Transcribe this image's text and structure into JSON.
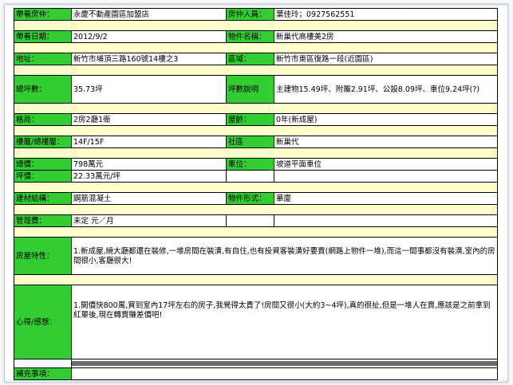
{
  "rows": {
    "r1": {
      "l1": "帶看房仲：",
      "v1": "永慶不動產園區加盟店",
      "l2": "房仲人員：",
      "v2": "葉佳玲；0927562551"
    },
    "r2": {
      "l1": "帶看日期：",
      "v1": "2012/9/2",
      "l2": "物件名稱：",
      "v2": "新巢代高樓美2房"
    },
    "r3": {
      "l1": "地址：",
      "v1": "新竹市埔頂三路160號14樓之3",
      "l2": "區域：",
      "v2": "新竹市東區復路一段(近園區)"
    },
    "r4": {
      "l1": "總坪數：",
      "v1": "35.73坪",
      "l2": "坪數說明",
      "v2": "主建物15.49坪、附屬2.91坪、公設8.09坪、車位9.24坪(?)"
    },
    "r5": {
      "l1": "格局：",
      "v1": "2房2廳1衛",
      "l2": "屋齡：",
      "v2": "0年(新成屋)"
    },
    "r6": {
      "l1": "樓層/總樓層：",
      "v1": "14F/15F",
      "l2": "社區",
      "v2": "新巢代"
    },
    "r7": {
      "l1": "總價：",
      "v1": "798萬元",
      "l2": "車位：",
      "v2": "坡道平面車位"
    },
    "r8": {
      "l1": "坪價：",
      "v1": "22.33萬元/坪",
      "l2": "",
      "v2": ""
    },
    "r9": {
      "l1": "建材結構：",
      "v1": "鋼筋混凝土",
      "l2": "物件形式：",
      "v2": "華廈"
    },
    "r10": {
      "l1": "管理費：",
      "v1": "未定 元／月"
    },
    "r11": {
      "l1": "房屋特性：",
      "v1": "1.新成屋,繞大廳都還在裝修,一堆房間在裝潢,有自住,也有投資客裝潢好要賣(網路上物件一堆),而這一間事都沒有裝潢,室內的房間很小,客廳很大!"
    },
    "r12": {
      "l1": "心得/感想：",
      "v1": "1.開價快800萬,買到室內17坪左右的房子,我覺得太貴了!房間又很小(大約3~4坪),真的很扯,但是一堆人在賣,應該是之前拿到紅單後,現在轉賣賺差價吧!"
    },
    "r13": {
      "l1": "補充事項：",
      "v1": ""
    }
  },
  "colors": {
    "label_bg": "#33cc33",
    "separator_bg": "#ffffcc",
    "border": "#000000"
  }
}
